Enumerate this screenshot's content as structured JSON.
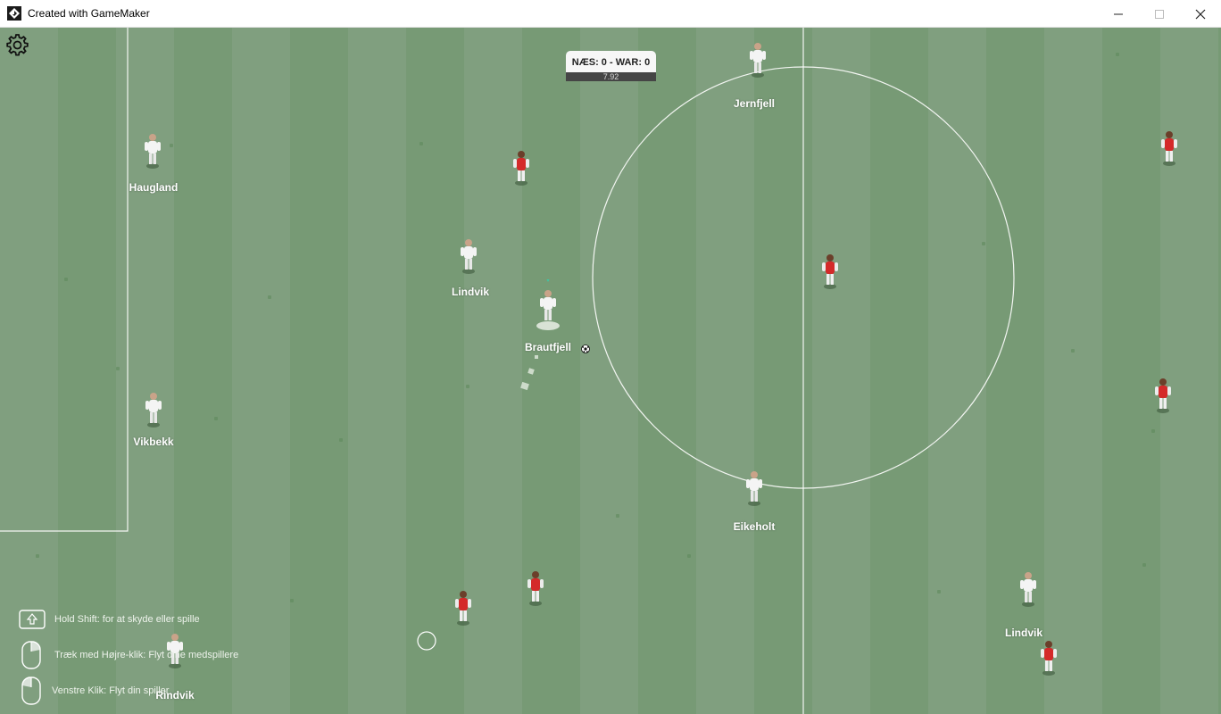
{
  "window": {
    "title": "Created with GameMaker",
    "icon": "gamemaker-logo-icon",
    "controls": [
      "minimize-icon",
      "maximize-icon",
      "close-icon"
    ]
  },
  "scoreboard": {
    "score_text": "NÆS: 0 - WAR: 0",
    "timer": "7.92"
  },
  "settings_icon": "gear-icon",
  "colors": {
    "grass_light": "#809f7f",
    "grass_dark": "#779a75",
    "line": "#ffffff",
    "home_kit": "#f4f4f4",
    "away_kit": "#d42a2a"
  },
  "labels": {
    "haugland": "Haugland",
    "vikbekk": "Vikbekk",
    "lindvik_1": "Lindvik",
    "brautfjell": "Brautfjell",
    "jernfjell": "Jernfjell",
    "eikeholt": "Eikeholt",
    "lindvik_2": "Lindvik",
    "rindvik": "Rindvik"
  },
  "hints": {
    "shift": "Hold Shift: for at skyde eller spille",
    "right_drag": "Træk med Højre-klik: Flyt dine medspillere",
    "left_click": "Venstre Klik: Flyt din spiller"
  }
}
